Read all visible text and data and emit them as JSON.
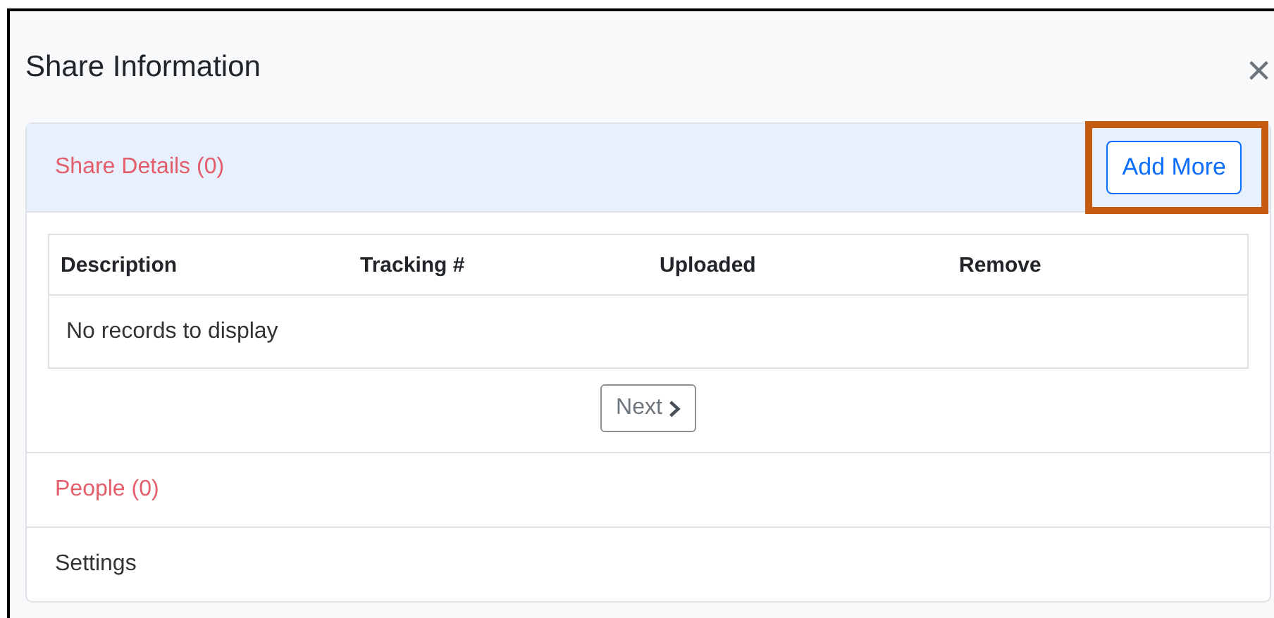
{
  "dialog": {
    "title": "Share Information",
    "close": "×"
  },
  "sections": [
    {
      "title": "Share Details (0)",
      "color": "#e35d6a",
      "expanded": true,
      "action": {
        "label": "Add More",
        "highlighted": true
      },
      "table": {
        "columns": [
          "Description",
          "Tracking #",
          "Uploaded",
          "Remove"
        ],
        "empty_message": "No records to display"
      },
      "pager": {
        "label": "Next",
        "disabled": true
      }
    },
    {
      "title": "People (0)",
      "color": "#e35d6a",
      "expanded": false
    },
    {
      "title": "Settings",
      "color": "#333333",
      "expanded": false
    }
  ]
}
